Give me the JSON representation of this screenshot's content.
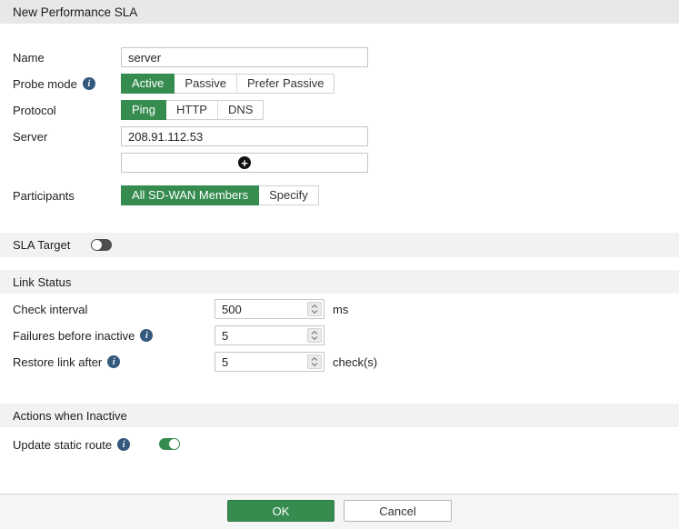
{
  "header": {
    "title": "New Performance SLA"
  },
  "icons": {
    "info_glyph": "i",
    "add_glyph": "+"
  },
  "colors": {
    "accent_green": "#368c4f",
    "info_blue": "#33597d",
    "toggle_off_gray": "#4d4d4d",
    "header_band": "#e8e8e8",
    "section_band": "#f2f2f2"
  },
  "form": {
    "name": {
      "label": "Name",
      "value": "server"
    },
    "probe_mode": {
      "label": "Probe mode",
      "options": [
        "Active",
        "Passive",
        "Prefer Passive"
      ],
      "selected": "Active"
    },
    "protocol": {
      "label": "Protocol",
      "options": [
        "Ping",
        "HTTP",
        "DNS"
      ],
      "selected": "Ping"
    },
    "server": {
      "label": "Server",
      "value": "208.91.112.53"
    },
    "participants": {
      "label": "Participants",
      "options": [
        "All SD-WAN Members",
        "Specify"
      ],
      "selected": "All SD-WAN Members"
    },
    "sla_target": {
      "label": "SLA Target",
      "enabled": false
    },
    "link_status": {
      "section_label": "Link Status",
      "check_interval": {
        "label": "Check interval",
        "value": "500",
        "suffix": "ms"
      },
      "failures_before_inactive": {
        "label": "Failures before inactive",
        "value": "5"
      },
      "restore_link_after": {
        "label": "Restore link after",
        "value": "5",
        "suffix": "check(s)"
      }
    },
    "actions_when_inactive": {
      "section_label": "Actions when Inactive",
      "update_static_route": {
        "label": "Update static route",
        "enabled": true
      }
    }
  },
  "footer": {
    "ok_label": "OK",
    "cancel_label": "Cancel"
  }
}
